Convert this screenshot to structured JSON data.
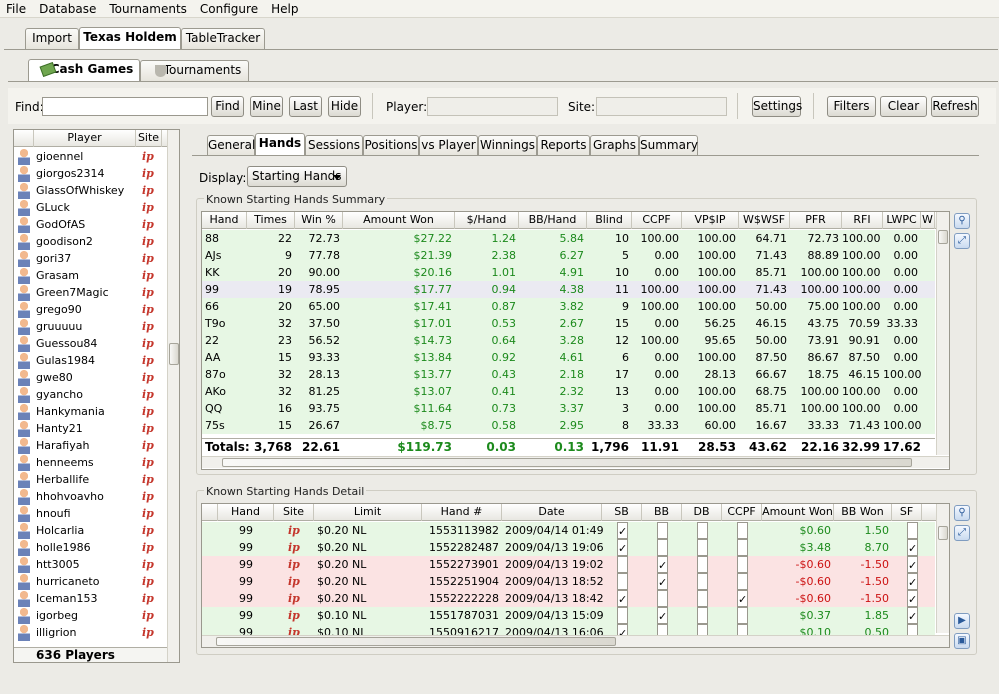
{
  "menu": [
    "File",
    "Database",
    "Tournaments",
    "Configure",
    "Help"
  ],
  "main_tabs": [
    "Import",
    "Texas Holdem",
    "TableTracker"
  ],
  "game_tabs": [
    "Cash Games",
    "Tournaments"
  ],
  "toolbar": {
    "find_label": "Find:",
    "find_value": "",
    "find_button": "Find",
    "mine_button": "Mine",
    "last_button": "Last",
    "hide_button": "Hide",
    "player_label": "Player:",
    "site_label": "Site:",
    "settings_button": "Settings",
    "filters_button": "Filters",
    "clear_button": "Clear",
    "refresh_button": "Refresh"
  },
  "player_list": {
    "col_player": "Player",
    "col_site": "Site",
    "site_icon": "ip-logo-icon",
    "players": [
      "gioennel",
      "giorgos2314",
      "GlassOfWhiskey",
      "GLuck",
      "GodOfAS",
      "goodison2",
      "gori37",
      "Grasam",
      "Green7Magic",
      "grego90",
      "gruuuuu",
      "Guessou84",
      "Gulas1984",
      "gwe80",
      "gyancho",
      "Hankymania",
      "Hanty21",
      "Harafiyah",
      "henneems",
      "Herballife",
      "hhohvoavho",
      "hnoufi",
      "Holcarlia",
      "holle1986",
      "htt3005",
      "hurricaneto",
      "Iceman153",
      "igorbeg",
      "illigrion"
    ],
    "count": "636 Players"
  },
  "stat_tabs": [
    "General",
    "Hands",
    "Sessions",
    "Positions",
    "vs Player",
    "Winnings",
    "Reports",
    "Graphs",
    "Summary"
  ],
  "display_label": "Display:",
  "display_value": "Starting Hands",
  "summary": {
    "title": "Known Starting Hands Summary",
    "columns": [
      "Hand",
      "Times",
      "Win %",
      "Amount Won",
      "$/Hand",
      "BB/Hand",
      "Blind",
      "CCPF",
      "VP$IP",
      "W$WSF",
      "PFR",
      "RFI",
      "LWPC",
      "W"
    ],
    "rows": [
      [
        "88",
        "22",
        "72.73",
        "$27.22",
        "1.24",
        "5.84",
        "10",
        "100.00",
        "100.00",
        "64.71",
        "72.73",
        "100.00",
        "0.00"
      ],
      [
        "AJs",
        "9",
        "77.78",
        "$21.39",
        "2.38",
        "6.27",
        "5",
        "0.00",
        "100.00",
        "71.43",
        "88.89",
        "100.00",
        "0.00"
      ],
      [
        "KK",
        "20",
        "90.00",
        "$20.16",
        "1.01",
        "4.91",
        "10",
        "0.00",
        "100.00",
        "85.71",
        "100.00",
        "100.00",
        "0.00"
      ],
      [
        "99",
        "19",
        "78.95",
        "$17.77",
        "0.94",
        "4.38",
        "11",
        "100.00",
        "100.00",
        "71.43",
        "100.00",
        "100.00",
        "0.00"
      ],
      [
        "66",
        "20",
        "65.00",
        "$17.41",
        "0.87",
        "3.82",
        "9",
        "100.00",
        "100.00",
        "50.00",
        "75.00",
        "100.00",
        "0.00"
      ],
      [
        "T9o",
        "32",
        "37.50",
        "$17.01",
        "0.53",
        "2.67",
        "15",
        "0.00",
        "56.25",
        "46.15",
        "43.75",
        "70.59",
        "33.33"
      ],
      [
        "22",
        "23",
        "56.52",
        "$14.73",
        "0.64",
        "3.28",
        "12",
        "100.00",
        "95.65",
        "50.00",
        "73.91",
        "90.91",
        "0.00"
      ],
      [
        "AA",
        "15",
        "93.33",
        "$13.84",
        "0.92",
        "4.61",
        "6",
        "0.00",
        "100.00",
        "87.50",
        "86.67",
        "87.50",
        "0.00"
      ],
      [
        "87o",
        "32",
        "28.13",
        "$13.77",
        "0.43",
        "2.18",
        "17",
        "0.00",
        "28.13",
        "66.67",
        "18.75",
        "46.15",
        "100.00"
      ],
      [
        "AKo",
        "32",
        "81.25",
        "$13.07",
        "0.41",
        "2.32",
        "13",
        "0.00",
        "100.00",
        "68.75",
        "100.00",
        "100.00",
        "0.00"
      ],
      [
        "QQ",
        "16",
        "93.75",
        "$11.64",
        "0.73",
        "3.37",
        "3",
        "0.00",
        "100.00",
        "85.71",
        "100.00",
        "100.00",
        "0.00"
      ],
      [
        "75s",
        "15",
        "26.67",
        "$8.75",
        "0.58",
        "2.95",
        "8",
        "33.33",
        "60.00",
        "16.67",
        "33.33",
        "71.43",
        "100.00"
      ]
    ],
    "totals": [
      "Totals:",
      "3,768",
      "22.61",
      "$119.73",
      "0.03",
      "0.13",
      "1,796",
      "11.91",
      "28.53",
      "43.62",
      "22.16",
      "32.99",
      "17.62"
    ]
  },
  "detail": {
    "title": "Known Starting Hands Detail",
    "columns": [
      "Hand",
      "Site",
      "Limit",
      "Hand #",
      "Date",
      "SB",
      "BB",
      "DB",
      "CCPF",
      "Amount Won",
      "BB Won",
      "SF"
    ],
    "rows": [
      {
        "hand": "99",
        "limit": "$0.20 NL",
        "num": "1553113982",
        "date": "2009/04/14 01:49",
        "sb": true,
        "bb": false,
        "db": false,
        "ccpf": false,
        "won": "$0.60",
        "bbwon": "1.50",
        "sf": false,
        "win": true
      },
      {
        "hand": "99",
        "limit": "$0.20 NL",
        "num": "1552282487",
        "date": "2009/04/13 19:06",
        "sb": true,
        "bb": false,
        "db": false,
        "ccpf": false,
        "won": "$3.48",
        "bbwon": "8.70",
        "sf": true,
        "win": true
      },
      {
        "hand": "99",
        "limit": "$0.20 NL",
        "num": "1552273901",
        "date": "2009/04/13 19:02",
        "sb": false,
        "bb": true,
        "db": false,
        "ccpf": false,
        "won": "-$0.60",
        "bbwon": "-1.50",
        "sf": true,
        "win": false
      },
      {
        "hand": "99",
        "limit": "$0.20 NL",
        "num": "1552251904",
        "date": "2009/04/13 18:52",
        "sb": false,
        "bb": true,
        "db": false,
        "ccpf": false,
        "won": "-$0.60",
        "bbwon": "-1.50",
        "sf": true,
        "win": false
      },
      {
        "hand": "99",
        "limit": "$0.20 NL",
        "num": "1552222228",
        "date": "2009/04/13 18:42",
        "sb": true,
        "bb": false,
        "db": false,
        "ccpf": true,
        "won": "-$0.60",
        "bbwon": "-1.50",
        "sf": true,
        "win": false
      },
      {
        "hand": "99",
        "limit": "$0.10 NL",
        "num": "1551787031",
        "date": "2009/04/13 15:09",
        "sb": false,
        "bb": true,
        "db": false,
        "ccpf": false,
        "won": "$0.37",
        "bbwon": "1.85",
        "sf": true,
        "win": true
      },
      {
        "hand": "99",
        "limit": "$0.10 NL",
        "num": "1550916217",
        "date": "2009/04/13 16:06",
        "sb": true,
        "bb": false,
        "db": false,
        "ccpf": false,
        "won": "$0.10",
        "bbwon": "0.50",
        "sf": false,
        "win": true
      }
    ]
  },
  "colors": {
    "win_row": "#e7f7e4",
    "loss_row": "#fbe3e3",
    "selected_row": "#ebeaf2",
    "positive": "#1c8a1c",
    "negative": "#cc1111"
  }
}
